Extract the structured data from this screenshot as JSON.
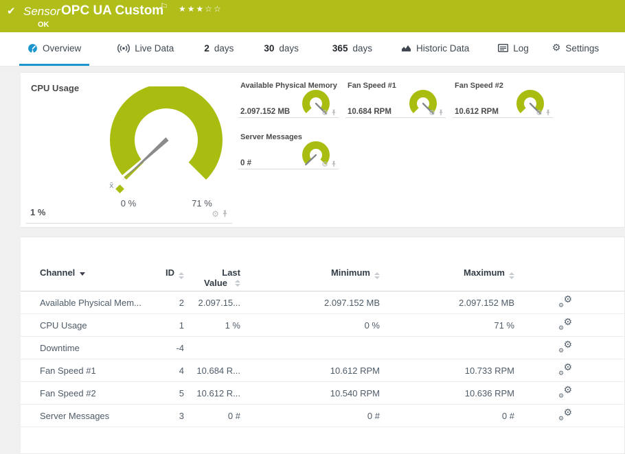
{
  "header": {
    "kind": "Sensor",
    "title": "OPC UA Custom",
    "status": "OK",
    "stars": "★★★☆☆",
    "priority_stars_filled": 3,
    "priority_stars_total": 5
  },
  "icons": {
    "check": "✔",
    "flag": "⚐",
    "gear": "⚙"
  },
  "tabs": [
    {
      "label": "Overview",
      "active": true
    },
    {
      "label": "Live Data"
    },
    {
      "prefix": "2",
      "label": "days"
    },
    {
      "prefix": "30",
      "label": "days"
    },
    {
      "prefix": "365",
      "label": "days"
    },
    {
      "label": "Historic Data"
    },
    {
      "label": "Log"
    },
    {
      "label": "Settings"
    }
  ],
  "gauges": {
    "cpu": {
      "title": "CPU Usage",
      "value": "1 %",
      "scale_min": "0 %",
      "scale_max": "71 %",
      "avg_marker": "x̄"
    },
    "mini": [
      {
        "title": "Available Physical Memory",
        "value": "2.097.152 MB",
        "needle": "high"
      },
      {
        "title": "Fan Speed #1",
        "value": "10.684 RPM",
        "needle": "high"
      },
      {
        "title": "Fan Speed #2",
        "value": "10.612 RPM",
        "needle": "high"
      },
      {
        "title": "Server Messages",
        "value": "0 #",
        "needle": "low"
      }
    ]
  },
  "table": {
    "headers": {
      "channel": "Channel",
      "id": "ID",
      "last_line1": "Last",
      "last_line2": "Value",
      "minimum": "Minimum",
      "maximum": "Maximum"
    },
    "rows": [
      {
        "channel": "Available Physical Mem...",
        "id": "2",
        "last": "2.097.15...",
        "min": "2.097.152 MB",
        "max": "2.097.152 MB"
      },
      {
        "channel": "CPU Usage",
        "id": "1",
        "last": "1 %",
        "min": "0 %",
        "max": "71 %"
      },
      {
        "channel": "Downtime",
        "id": "-4",
        "last": "",
        "min": "",
        "max": ""
      },
      {
        "channel": "Fan Speed #1",
        "id": "4",
        "last": "10.684 R...",
        "min": "10.612 RPM",
        "max": "10.733 RPM"
      },
      {
        "channel": "Fan Speed #2",
        "id": "5",
        "last": "10.612 R...",
        "min": "10.540 RPM",
        "max": "10.636 RPM"
      },
      {
        "channel": "Server Messages",
        "id": "3",
        "last": "0 #",
        "min": "0 #",
        "max": "0 #"
      }
    ]
  },
  "colors": {
    "header_green": "#b1bd18",
    "gauge_green": "#a9bc10",
    "accent_blue": "#1d96cf"
  }
}
